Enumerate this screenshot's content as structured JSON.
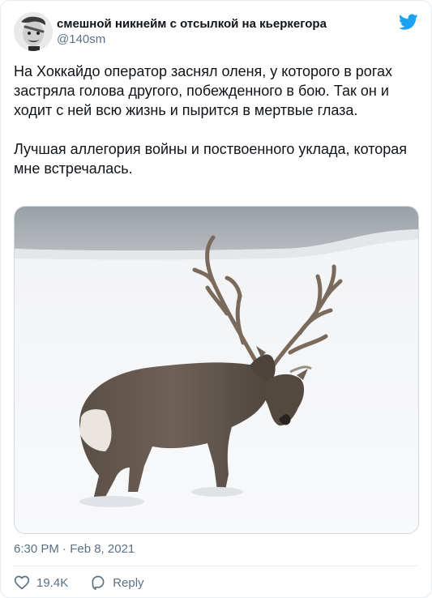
{
  "author": {
    "display_name": "смешной никнейм с отсылкой на кьеркегора",
    "handle": "@140sm"
  },
  "tweet": {
    "paragraphs": [
      "На Хоккайдо оператор заснял оленя, у которого в рогах застряла голова другого, побежденного в бою. Так он и ходит с ней всю жизнь и пырится в мертвые глаза.",
      "Лучшая аллегория войны и поствоенного уклада, которая мне встречалась."
    ],
    "timestamp": "6:30 PM · Feb 8, 2021"
  },
  "actions": {
    "likes": "19.4K",
    "reply_label": "Reply"
  },
  "icons": {
    "brand": "twitter-bird-icon",
    "like": "heart-icon",
    "reply": "speech-bubble-icon"
  },
  "colors": {
    "brand": "#1da1f2",
    "text": "#0f1419",
    "secondary": "#5b7083",
    "border": "#e6ecf0"
  }
}
